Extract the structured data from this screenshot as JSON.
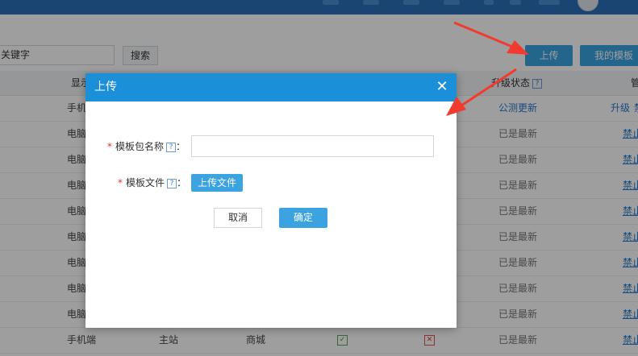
{
  "toolbar": {
    "search_value": "关键字",
    "search_button": "搜索",
    "upload_button": "上传",
    "my_templates_button": "我的模板"
  },
  "table": {
    "headers": {
      "display": "显示",
      "upgrade_status": "升级状态",
      "manage": "管"
    },
    "rows": [
      {
        "device": "手机",
        "status": "公测更新",
        "status_link": true,
        "actions": [
          "升级",
          "禁"
        ]
      },
      {
        "device": "电脑",
        "status": "已是最新",
        "status_link": false,
        "actions": [
          "禁止"
        ]
      },
      {
        "device": "电脑",
        "status": "已是最新",
        "status_link": false,
        "actions": [
          "禁止"
        ]
      },
      {
        "device": "电脑",
        "status": "已是最新",
        "status_link": false,
        "actions": [
          "禁止"
        ]
      },
      {
        "device": "电脑",
        "status": "已是最新",
        "status_link": false,
        "actions": [
          "禁止"
        ]
      },
      {
        "device": "电脑",
        "status": "已是最新",
        "status_link": false,
        "actions": [
          "禁止"
        ]
      },
      {
        "device": "电脑",
        "status": "已是最新",
        "status_link": false,
        "actions": [
          "禁止"
        ]
      },
      {
        "device": "电脑",
        "status": "已是最新",
        "status_link": false,
        "actions": [
          "禁止"
        ]
      },
      {
        "device": "电脑",
        "status": "已是最新",
        "status_link": false,
        "actions": [
          "禁止"
        ]
      }
    ],
    "last_row": {
      "device": "手机端",
      "station": "主站",
      "mall": "商城",
      "status": "已是最新",
      "action": "禁止"
    }
  },
  "modal": {
    "title": "上传",
    "name_label": "模板包名称",
    "file_label": "模板文件",
    "required_mark": "*",
    "colon": "：",
    "help_icon": "?",
    "upload_file_button": "上传文件",
    "cancel_button": "取消",
    "confirm_button": "确定"
  },
  "colors": {
    "primary": "#3aa3e0",
    "header_blue": "#1b8fd8",
    "arrow_red": "#f23b2e",
    "link_blue": "#2b7ac9"
  }
}
